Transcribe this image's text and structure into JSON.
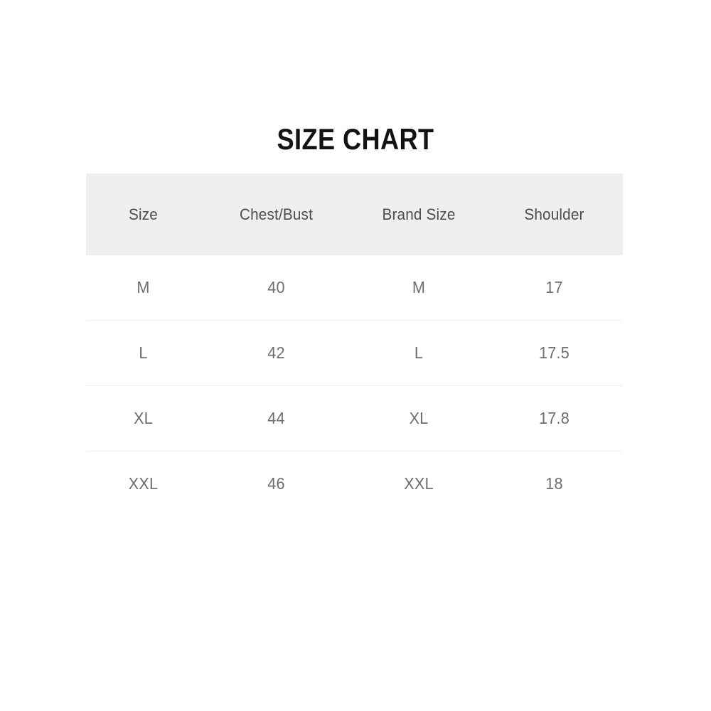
{
  "title": "SIZE CHART",
  "colors": {
    "page_background": "#ffffff",
    "title_text": "#131313",
    "header_background": "#efefef",
    "header_text": "#4c4c4c",
    "body_text": "#6e6e6e",
    "row_divider": "#f1f1f1"
  },
  "table": {
    "columns": [
      {
        "key": "size",
        "label": "Size"
      },
      {
        "key": "chest_bust",
        "label": "Chest/Bust"
      },
      {
        "key": "brand_size",
        "label": "Brand Size"
      },
      {
        "key": "shoulder",
        "label": "Shoulder"
      }
    ],
    "rows": [
      {
        "size": "M",
        "chest_bust": "40",
        "brand_size": "M",
        "shoulder": "17"
      },
      {
        "size": "L",
        "chest_bust": "42",
        "brand_size": "L",
        "shoulder": "17.5"
      },
      {
        "size": "XL",
        "chest_bust": "44",
        "brand_size": "XL",
        "shoulder": "17.8"
      },
      {
        "size": "XXL",
        "chest_bust": "46",
        "brand_size": "XXL",
        "shoulder": "18"
      }
    ]
  },
  "chart_data": {
    "type": "table",
    "title": "SIZE CHART",
    "columns": [
      "Size",
      "Chest/Bust",
      "Brand Size",
      "Shoulder"
    ],
    "rows": [
      [
        "M",
        "40",
        "M",
        "17"
      ],
      [
        "L",
        "42",
        "L",
        "17.5"
      ],
      [
        "XL",
        "44",
        "XL",
        "17.8"
      ],
      [
        "XXL",
        "46",
        "XXL",
        "18"
      ]
    ]
  }
}
